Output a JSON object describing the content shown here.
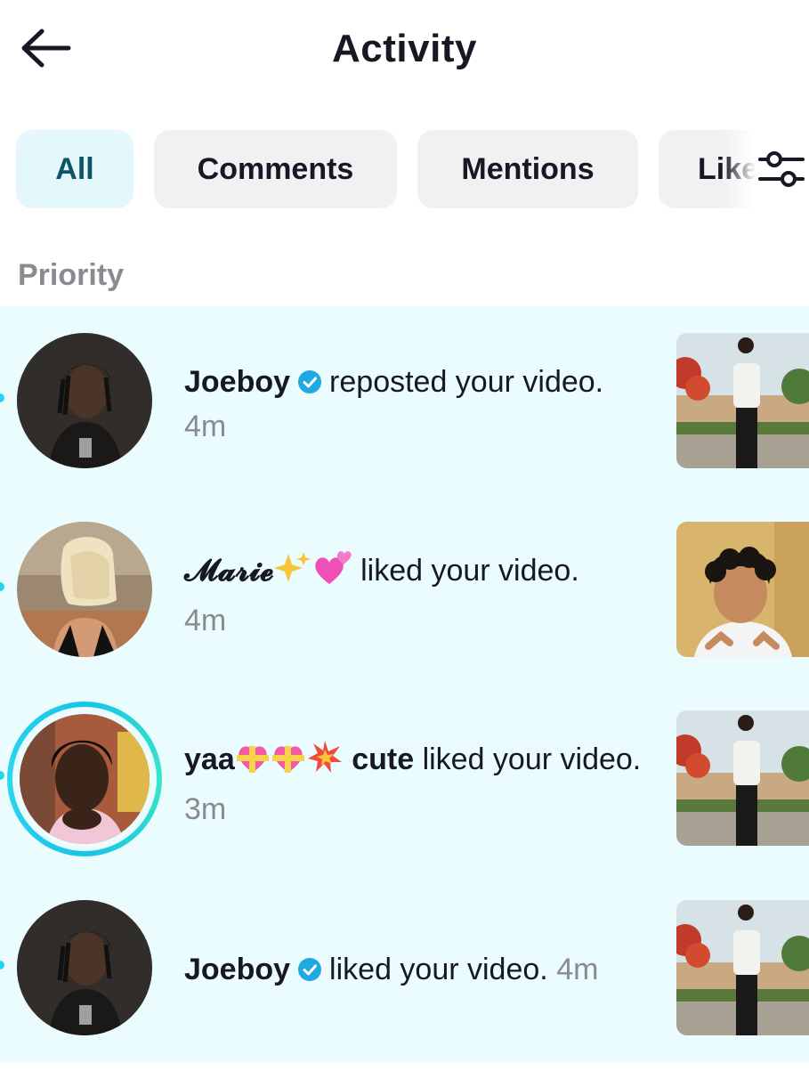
{
  "header": {
    "title": "Activity"
  },
  "tabs": [
    {
      "label": "All",
      "active": true
    },
    {
      "label": "Comments",
      "active": false
    },
    {
      "label": "Mentions",
      "active": false
    },
    {
      "label": "Likes",
      "active": false
    }
  ],
  "section_label": "Priority",
  "notifications": [
    {
      "name": "Joeboy",
      "verified": true,
      "action": "reposted your video.",
      "time": "4m"
    },
    {
      "name": "𝓜𝓪𝓻𝓲𝓮",
      "verified": false,
      "action": "liked your video.",
      "time": "4m"
    },
    {
      "name": "yaa",
      "name_suffix": "cute",
      "verified": false,
      "story": true,
      "action": "liked your video.",
      "time": "3m"
    },
    {
      "name": "Joeboy",
      "verified": true,
      "action": "liked your video.",
      "time": "4m"
    }
  ],
  "colors": {
    "accent": "#20d5ec",
    "active_tab_bg": "#e4f7fb",
    "active_tab_text": "#0b5566",
    "priority_bg": "#ebfcfe",
    "verified": "#20a8e0"
  },
  "icons": {
    "back": "arrow-left-icon",
    "filter": "sliders-icon",
    "verified": "verified-badge-icon"
  }
}
